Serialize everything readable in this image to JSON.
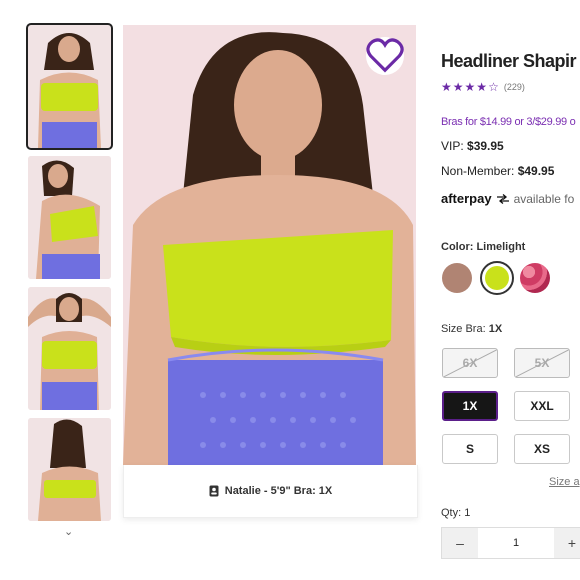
{
  "product": {
    "title": "Headliner Shapir",
    "rating_stars": 4.5,
    "review_count": "(229)",
    "promo": "Bras for $14.99 or 3/$29.99 o",
    "vip_label": "VIP:",
    "vip_price": "$39.95",
    "nonmember_label": "Non-Member:",
    "nonmember_price": "$49.95",
    "afterpay_brand": "afterpay",
    "afterpay_text": "available fo"
  },
  "color": {
    "label": "Color:",
    "selected": "Limelight",
    "swatches": [
      {
        "name": "Mocha",
        "hex": "#b08473"
      },
      {
        "name": "Limelight",
        "hex": "#c9e11b"
      },
      {
        "name": "Pink Animal",
        "hex": "#cf3c64"
      }
    ]
  },
  "size": {
    "label": "Size Bra:",
    "selected": "1X",
    "options": [
      {
        "label": "6X",
        "available": false
      },
      {
        "label": "5X",
        "available": false
      },
      {
        "label": "1X",
        "available": true
      },
      {
        "label": "XXL",
        "available": true
      },
      {
        "label": "S",
        "available": true
      },
      {
        "label": "XS",
        "available": true
      }
    ],
    "guide_link": "Size a"
  },
  "qty": {
    "label": "Qty:",
    "value": "1",
    "minus": "–",
    "plus": "+"
  },
  "model_caption": "Natalie - 5'9\" Bra: 1X",
  "colors": {
    "accent": "#6b2aa6",
    "limelight": "#c9e11b",
    "skirt": "#6f6fe0"
  }
}
